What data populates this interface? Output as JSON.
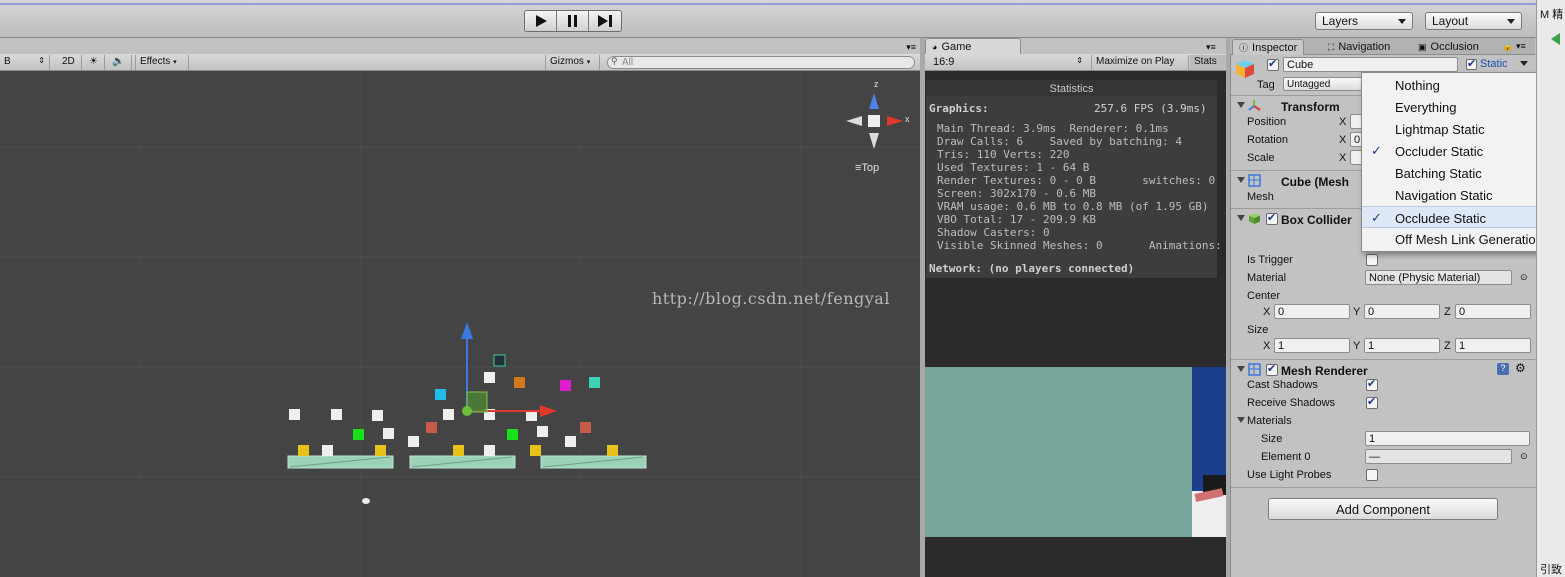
{
  "toolbar": {
    "layers_label": "Layers",
    "layout_label": "Layout"
  },
  "scene": {
    "shading_value": "B",
    "mode_2d": "2D",
    "effects_label": "Effects",
    "gizmos_label": "Gizmos",
    "search_placeholder": "All",
    "gizmo_axis_z": "z",
    "gizmo_axis_x": "x",
    "view_label": "Top",
    "watermark": "http://blog.csdn.net/fengyal"
  },
  "game": {
    "tab_label": "Game",
    "aspect_value": "16:9",
    "maximize_label": "Maximize on Play",
    "stats_label": "Stats",
    "stats": {
      "title": "Statistics",
      "graphics_label": "Graphics:",
      "fps": "257.6 FPS (3.9ms)",
      "lines": [
        "Main Thread: 3.9ms  Renderer: 0.1ms",
        "Draw Calls: 6    Saved by batching: 4",
        "Tris: 110 Verts: 220",
        "Used Textures: 1 - 64 B",
        "Render Textures: 0 - 0 B       switches: 0",
        "Screen: 302x170 - 0.6 MB",
        "VRAM usage: 0.6 MB to 0.8 MB (of 1.95 GB)",
        "VBO Total: 17 - 209.9 KB",
        "Shadow Casters: 0",
        "Visible Skinned Meshes: 0       Animations: 0"
      ],
      "network": "Network: (no players connected)"
    }
  },
  "inspector": {
    "tabs": [
      "Inspector",
      "Navigation",
      "Occlusion"
    ],
    "object_name": "Cube",
    "static_label": "Static",
    "tag_label": "Tag",
    "tag_value": "Untagged",
    "transform": {
      "title": "Transform",
      "position_label": "Position",
      "rotation_label": "Rotation",
      "scale_label": "Scale",
      "x_label": "X",
      "rotation_x_partial": "0"
    },
    "mesh_filter": {
      "title": "Cube (Mesh",
      "mesh_label": "Mesh"
    },
    "box_collider": {
      "title": "Box Collider",
      "is_trigger_label": "Is Trigger",
      "material_label": "Material",
      "material_value": "None (Physic Material)",
      "center_label": "Center",
      "center": {
        "x": "0",
        "y": "0",
        "z": "0"
      },
      "size_label": "Size",
      "size": {
        "x": "1",
        "y": "1",
        "z": "1"
      },
      "axis_x": "X",
      "axis_y": "Y",
      "axis_z": "Z"
    },
    "mesh_renderer": {
      "title": "Mesh Renderer",
      "cast_shadows_label": "Cast Shadows",
      "receive_shadows_label": "Receive Shadows",
      "materials_label": "Materials",
      "size_label": "Size",
      "size_value": "1",
      "element0_label": "Element 0",
      "element0_value": "—",
      "light_probes_label": "Use Light Probes"
    },
    "add_component_label": "Add Component"
  },
  "static_menu": {
    "items": [
      {
        "label": "Nothing",
        "checked": false
      },
      {
        "label": "Everything",
        "checked": false
      },
      {
        "label": "Lightmap Static",
        "checked": false
      },
      {
        "label": "Occluder Static",
        "checked": true
      },
      {
        "label": "Batching Static",
        "checked": false
      },
      {
        "label": "Navigation Static",
        "checked": false
      },
      {
        "label": "Occludee Static",
        "checked": true
      },
      {
        "label": "Off Mesh Link Generation",
        "checked": false
      }
    ],
    "check_mark": "✓"
  },
  "right_strip": {
    "top_text": "M 精",
    "bottom_text": "引致"
  },
  "colors": {
    "scene_bg": "#444444",
    "game_sky": "#78a69c",
    "game_blue": "#1c3f8c",
    "axis_red": "#e0382b",
    "axis_blue": "#3a78e0",
    "axis_green": "#6bbf3a",
    "platform": "#9cd3b8",
    "menu_highlight": "#dfe8f6"
  }
}
